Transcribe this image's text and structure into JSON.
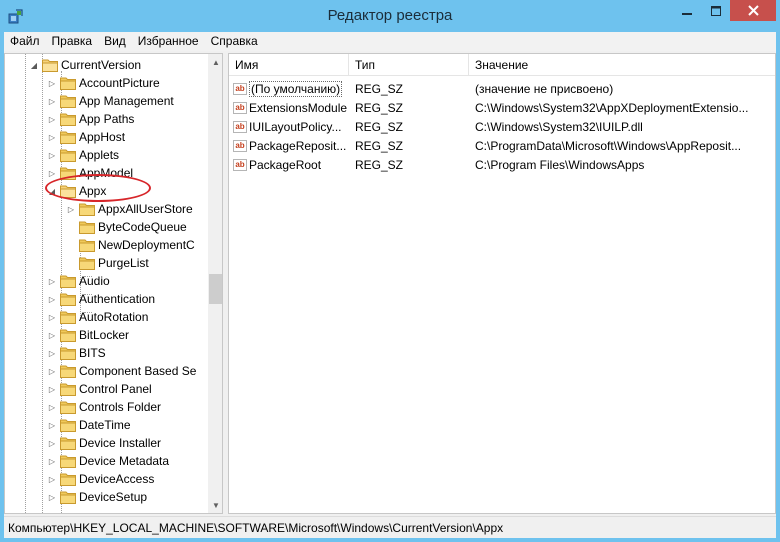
{
  "window": {
    "title": "Редактор реестра",
    "frame_color": "#6ec2ee",
    "close_color": "#c7504c"
  },
  "menu": [
    "Файл",
    "Правка",
    "Вид",
    "Избранное",
    "Справка"
  ],
  "tree": {
    "root": "CurrentVersion",
    "items": [
      "AccountPicture",
      "App Management",
      "App Paths",
      "AppHost",
      "Applets",
      "AppModel",
      "Appx",
      "AppxAllUserStore",
      "ByteCodeQueue",
      "NewDeploymentC",
      "PurgeList",
      "Audio",
      "Authentication",
      "AutoRotation",
      "BitLocker",
      "BITS",
      "Component Based Se",
      "Control Panel",
      "Controls Folder",
      "DateTime",
      "Device Installer",
      "Device Metadata",
      "DeviceAccess",
      "DeviceSetup"
    ],
    "selected": "Appx"
  },
  "list": {
    "columns": [
      "Имя",
      "Тип",
      "Значение"
    ],
    "rows": [
      {
        "name": "(По умолчанию)",
        "type": "REG_SZ",
        "data": "(значение не присвоено)"
      },
      {
        "name": "ExtensionsModule",
        "type": "REG_SZ",
        "data": "C:\\Windows\\System32\\AppXDeploymentExtensio..."
      },
      {
        "name": "IUILayoutPolicy...",
        "type": "REG_SZ",
        "data": "C:\\Windows\\System32\\IUILP.dll"
      },
      {
        "name": "PackageReposit...",
        "type": "REG_SZ",
        "data": "C:\\ProgramData\\Microsoft\\Windows\\AppReposit..."
      },
      {
        "name": "PackageRoot",
        "type": "REG_SZ",
        "data": "C:\\Program Files\\WindowsApps"
      }
    ],
    "value_icon": "ab"
  },
  "status": {
    "path": "Компьютер\\HKEY_LOCAL_MACHINE\\SOFTWARE\\Microsoft\\Windows\\CurrentVersion\\Appx"
  },
  "annotation": {
    "color": "#d7262a",
    "target": "Appx"
  }
}
